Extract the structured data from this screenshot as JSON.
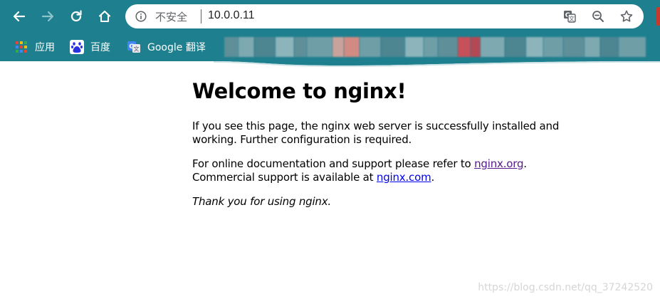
{
  "browser": {
    "omnibox": {
      "security_label": "不安全",
      "separator": "|",
      "url": "10.0.0.11"
    },
    "icons": {
      "back": "back-arrow-icon",
      "forward": "forward-arrow-icon",
      "reload": "reload-icon",
      "home": "home-icon",
      "info": "info-icon",
      "translate": "translate-icon",
      "zoom": "zoom-icon",
      "bookmark_star": "star-icon"
    },
    "colors": {
      "chrome": "#1e7f8e",
      "omnibox_bg": "#ffffff",
      "icon": "#ffffff",
      "icon_disabled": "#8fc3cb"
    }
  },
  "bookmarks": {
    "items": [
      {
        "label": "应用",
        "icon": "apps-grid-icon"
      },
      {
        "label": "百度",
        "icon": "baidu-paw-icon"
      },
      {
        "label": "Google 翻译",
        "icon": "google-translate-icon"
      }
    ]
  },
  "page": {
    "title": "Welcome to nginx!",
    "para1": "If you see this page, the nginx web server is successfully installed and working. Further configuration is required.",
    "para2_prefix": "For online documentation and support please refer to ",
    "link1": "nginx.org",
    "para2_mid": ".",
    "para2_line2": "Commercial support is available at ",
    "link2": "nginx.com",
    "para2_end": ".",
    "thanks": "Thank you for using nginx."
  },
  "watermark": "https://blog.csdn.net/qq_37242520"
}
